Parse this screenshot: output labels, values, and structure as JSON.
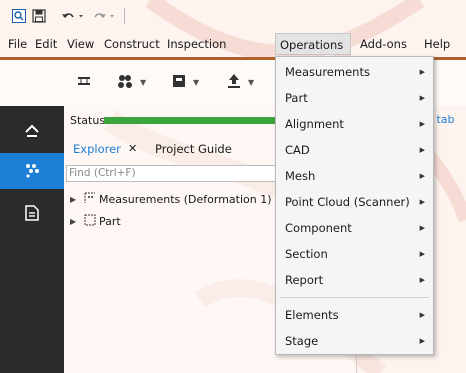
{
  "quick_access": {
    "icons": [
      "app-icon",
      "save-icon",
      "undo-icon",
      "redo-icon"
    ]
  },
  "menubar": {
    "items": [
      "File",
      "Edit",
      "View",
      "Construct",
      "Inspection",
      "Operations",
      "Add-ons",
      "Help"
    ],
    "active": "Operations"
  },
  "ribbon": {
    "icons": [
      "section-tool-icon",
      "cluster-icon",
      "component-icon",
      "export-icon"
    ]
  },
  "nav": {
    "icons": [
      "home-icon",
      "explorer-icon",
      "report-icon"
    ]
  },
  "panel": {
    "status_label": "Status",
    "tabs": {
      "explorer": "Explorer",
      "close": "✕",
      "project_guide": "Project Guide"
    },
    "find_placeholder": "Find (Ctrl+F)",
    "tree": [
      {
        "label": "Measurements (Deformation 1)"
      },
      {
        "label": "Part"
      }
    ]
  },
  "right_fragment": "n tab",
  "operations_menu": {
    "items": [
      {
        "label": "Measurements",
        "has_submenu": true
      },
      {
        "label": "Part",
        "has_submenu": true
      },
      {
        "label": "Alignment",
        "has_submenu": true
      },
      {
        "label": "CAD",
        "has_submenu": true
      },
      {
        "label": "Mesh",
        "has_submenu": true
      },
      {
        "label": "Point Cloud (Scanner)",
        "has_submenu": true
      },
      {
        "label": "Component",
        "has_submenu": true
      },
      {
        "label": "Section",
        "has_submenu": true
      },
      {
        "label": "Report",
        "has_submenu": true
      },
      {
        "label": "Elements",
        "has_submenu": true
      },
      {
        "label": "Stage",
        "has_submenu": true
      }
    ],
    "submenu_glyph": "▶"
  },
  "colors": {
    "accent": "#1d7fd6",
    "status_green": "#3aa53a",
    "brand_line": "#b0612b",
    "nav_bg": "#2b2b2b"
  }
}
